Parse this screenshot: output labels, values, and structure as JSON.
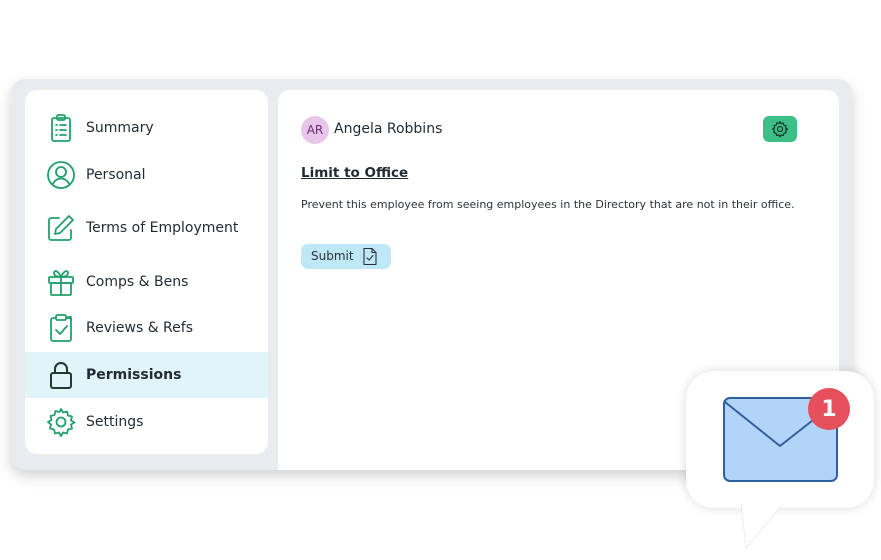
{
  "sidebar": {
    "items": [
      {
        "label": "Summary",
        "icon": "clipboard-list-icon"
      },
      {
        "label": "Personal",
        "icon": "user-circle-icon"
      },
      {
        "label": "Terms of Employment",
        "icon": "pencil-square-icon"
      },
      {
        "label": "Comps & Bens",
        "icon": "gift-icon"
      },
      {
        "label": "Reviews & Refs",
        "icon": "clipboard-check-icon"
      },
      {
        "label": "Permissions",
        "icon": "lock-icon",
        "active": true
      },
      {
        "label": "Settings",
        "icon": "gear-icon"
      }
    ]
  },
  "employee": {
    "initials": "AR",
    "name": "Angela Robbins"
  },
  "permission": {
    "title": "Limit to Office",
    "description": "Prevent this employee from seeing employees in the Directory that are not in their office.",
    "submit_label": "Submit"
  },
  "notification": {
    "count": "1",
    "icon": "envelope-icon"
  },
  "colors": {
    "accent_green": "#3fbf88",
    "icon_green": "#22a06b",
    "active_bg": "#e1f4fa",
    "submit_bg": "#bfe8f6",
    "badge_red": "#e5505c",
    "envelope_blue": "#b3d4f9"
  }
}
